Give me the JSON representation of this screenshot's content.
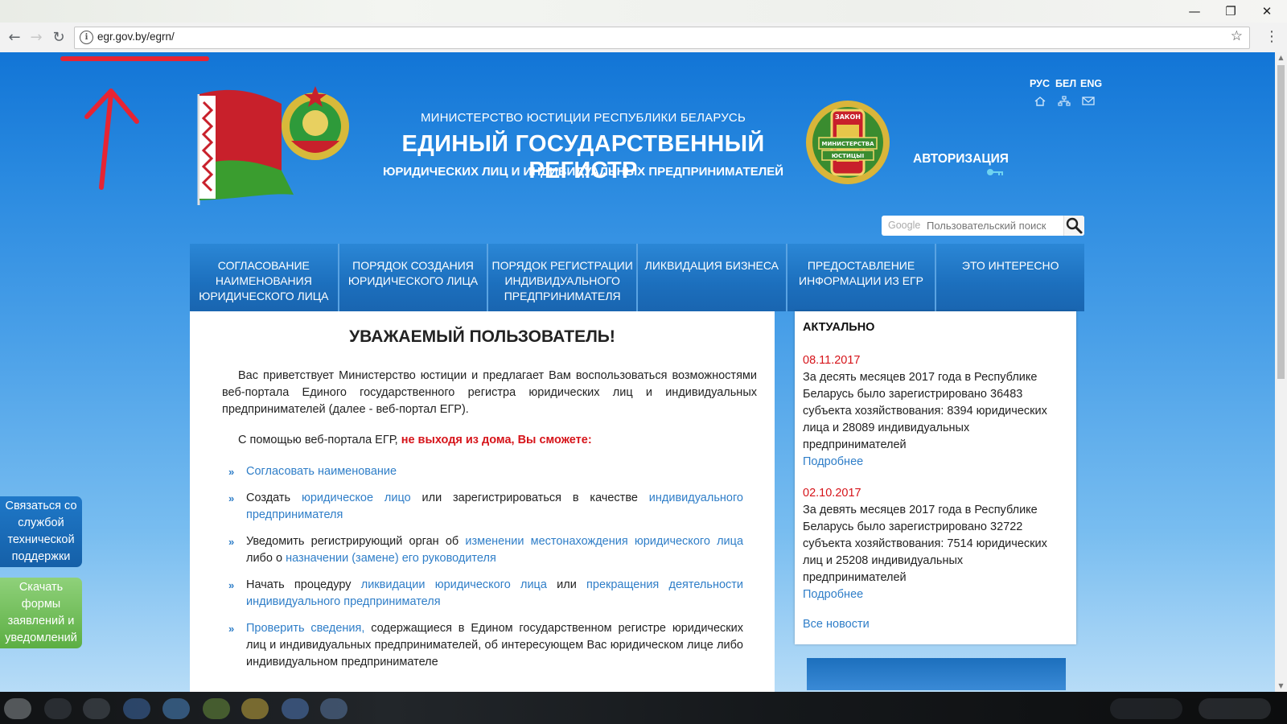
{
  "browser": {
    "url": "egr.gov.by/egrn/",
    "back_icon": "back-arrow-icon",
    "forward_icon": "forward-arrow-icon",
    "reload_icon": "reload-icon",
    "bookmark_icon": "star-icon",
    "window_controls": [
      "minimize-icon",
      "restore-icon",
      "close-icon"
    ]
  },
  "header": {
    "ministry": "МИНИСТЕРСТВО ЮСТИЦИИ РЕСПУБЛИКИ БЕЛАРУСЬ",
    "title": "ЕДИНЫЙ ГОСУДАРСТВЕННЫЙ РЕГИСТР",
    "subtitle": "ЮРИДИЧЕСКИХ ЛИЦ И ИНДИВИДУАЛЬНЫХ ПРЕДПРИНИМАТЕЛЕЙ",
    "auth": "АВТОРИЗАЦИЯ",
    "languages": [
      "РУС",
      "БЕЛ",
      "ENG"
    ],
    "search_placeholder": "Пользовательский поиск",
    "search_brand": "Google"
  },
  "badge_text": {
    "top": "ЗАКОН",
    "middle": "МИНИСТЕРСТВА",
    "bottom": "ЮСТИЦЫІ"
  },
  "nav": [
    "СОГЛАСОВАНИЕ НАИМЕНОВАНИЯ ЮРИДИЧЕСКОГО ЛИЦА",
    "ПОРЯДОК СОЗДАНИЯ ЮРИДИЧЕСКОГО ЛИЦА",
    "ПОРЯДОК РЕГИСТРАЦИИ ИНДИВИДУАЛЬНОГО ПРЕДПРИНИМАТЕЛЯ",
    "ЛИКВИДАЦИЯ БИЗНЕСА",
    "ПРЕДОСТАВЛЕНИЕ ИНФОРМАЦИИ ИЗ ЕГР",
    "ЭТО ИНТЕРЕСНО"
  ],
  "main": {
    "heading": "УВАЖАЕМЫЙ ПОЛЬЗОВАТЕЛЬ!",
    "intro": "Вас приветствует Министерство юстиции и предлагает Вам воспользоваться возможностями веб-портала Единого государственного регистра юридических лиц и индивидуальных предпринимателей (далее - веб-портал ЕГР).",
    "can_prefix": "С помощью веб-портала ЕГР, ",
    "can_highlight": "не выходя из дома, Вы сможете:",
    "b1_link": "Согласовать наименование",
    "b2_text1": "Создать ",
    "b2_link1": "юридическое лицо",
    "b2_text2": " или зарегистрироваться в качестве ",
    "b2_link2": "индивидуального предпринимателя",
    "b3_text1": "Уведомить регистрирующий орган об ",
    "b3_link1": "изменении местонахождения юридического лица",
    "b3_text2": " либо о ",
    "b3_link2": "назначении (замене) его руководителя",
    "b4_text1": "Начать процедуру ",
    "b4_link1": "ликвидации юридического лица",
    "b4_text2": " или ",
    "b4_link2": "прекращения деятельности индивидуального предпринимателя",
    "b5_link1": "Проверить сведения,",
    "b5_text1": " содержащиеся в Едином государственном регистре юридических лиц и индивидуальных предпринимателей, об интересующем Вас юридическом лице либо индивидуальном предпринимателе"
  },
  "sidebar": {
    "title": "АКТУАЛЬНО",
    "news": [
      {
        "date": "08.11.2017",
        "text": "За десять месяцев 2017 года в Республике Беларусь было зарегистрировано 36483 субъекта хозяйствования: 8394 юридических лица и 28089 индивидуальных предпринимателей",
        "more": "Подробнее"
      },
      {
        "date": "02.10.2017",
        "text": "За девять месяцев 2017 года в Республике Беларусь было зарегистрировано 32722 субъекта хозяйствования: 7514 юридических лиц и 25208 индивидуальных предпринимателей",
        "more": "Подробнее"
      }
    ],
    "all_news": "Все новости"
  },
  "tabs": {
    "support": "Связаться со службой технической поддержки",
    "forms": "Скачать формы заявлений и уведомлений"
  },
  "colors": {
    "accent_blue": "#1c6fbd",
    "link": "#2f7ec8",
    "date_red": "#d6141a",
    "annotation_red": "#e62433",
    "green_tab": "#6fbf55"
  }
}
